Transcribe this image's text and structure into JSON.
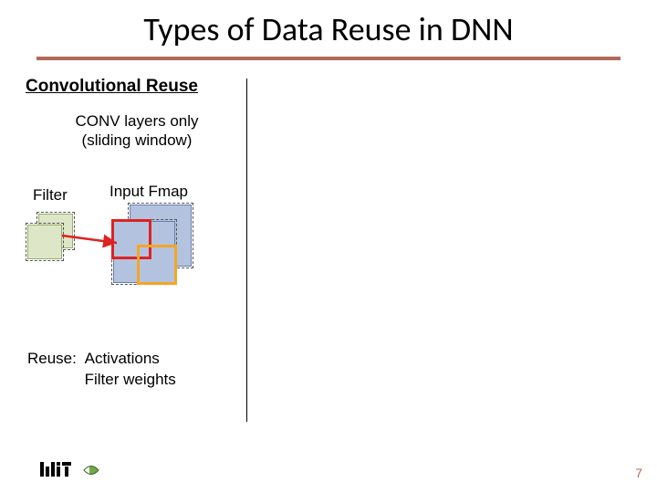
{
  "title": "Types of Data Reuse in DNN",
  "section": "Convolutional Reuse",
  "subheading_line1": "CONV layers only",
  "subheading_line2": "(sliding window)",
  "labels": {
    "filter": "Filter",
    "input_fmap": "Input Fmap"
  },
  "reuse": {
    "prefix": "Reuse:",
    "items": [
      "Activations",
      "Filter weights"
    ]
  },
  "page_number": "7",
  "colors": {
    "accent_rule": "#b06a5a",
    "fmap_fill": "#b3c3df",
    "filter_fill": "#dde6c6",
    "highlight_red": "#d22",
    "highlight_orange": "#f5a623"
  }
}
